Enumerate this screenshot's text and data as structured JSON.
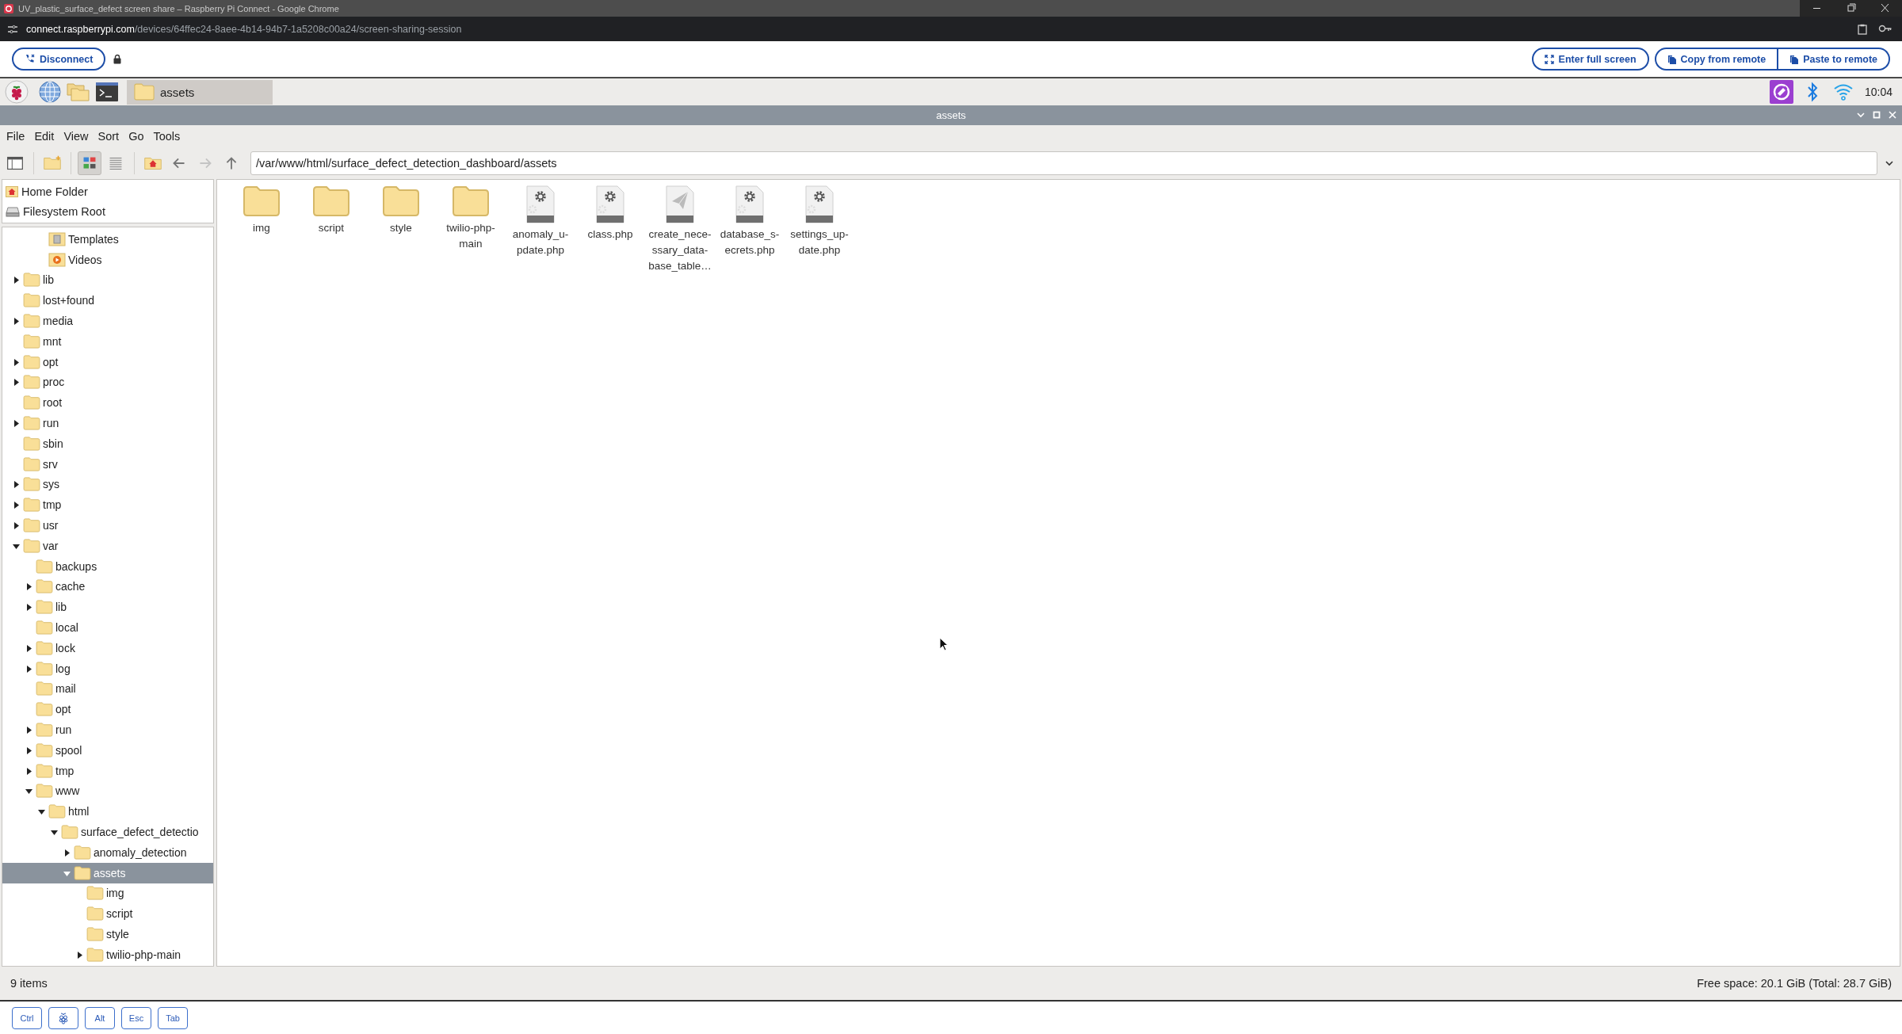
{
  "browser": {
    "title": "UV_plastic_surface_defect screen share – Raspberry Pi Connect - Google Chrome",
    "url_host": "connect.raspberrypi.com",
    "url_path": "/devices/64ffec24-8aee-4b14-94b7-1a5208c00a24/screen-sharing-session"
  },
  "connect_toolbar": {
    "disconnect": "Disconnect",
    "fullscreen": "Enter full screen",
    "copy": "Copy from remote",
    "paste": "Paste to remote"
  },
  "taskbar": {
    "window_button": "assets",
    "clock": "10:04"
  },
  "window": {
    "title": "assets",
    "menu": [
      "File",
      "Edit",
      "View",
      "Sort",
      "Go",
      "Tools"
    ],
    "view_buttons": [
      {
        "kind": "icons",
        "selected": true
      },
      {
        "kind": "list",
        "selected": false
      }
    ],
    "navigation": [
      {
        "kind": "back",
        "disabled": false
      },
      {
        "kind": "forward",
        "disabled": true
      },
      {
        "kind": "up",
        "disabled": false
      }
    ],
    "path": "/var/www/html/surface_defect_detection_dashboard/assets",
    "places": [
      {
        "kind": "home",
        "label": "Home Folder"
      },
      {
        "kind": "drive",
        "label": "Filesystem Root"
      }
    ],
    "tree": {
      "partial_branch": [
        {
          "kind": "templates",
          "label": "Templates"
        },
        {
          "kind": "videos",
          "label": "Videos"
        }
      ],
      "items": [
        {
          "label": "lib",
          "expandable": true,
          "expanded": false,
          "selected": false
        },
        {
          "label": "lost+found",
          "expandable": false,
          "selected": false
        },
        {
          "label": "media",
          "expandable": true,
          "expanded": false,
          "selected": false
        },
        {
          "label": "mnt",
          "expandable": false,
          "selected": false
        },
        {
          "label": "opt",
          "expandable": true,
          "expanded": false,
          "selected": false
        },
        {
          "label": "proc",
          "expandable": true,
          "expanded": false,
          "selected": false
        },
        {
          "label": "root",
          "expandable": false,
          "selected": false
        },
        {
          "label": "run",
          "expandable": true,
          "expanded": false,
          "selected": false
        },
        {
          "label": "sbin",
          "expandable": false,
          "selected": false
        },
        {
          "label": "srv",
          "expandable": false,
          "selected": false
        },
        {
          "label": "sys",
          "expandable": true,
          "expanded": false,
          "selected": false
        },
        {
          "label": "tmp",
          "expandable": true,
          "expanded": false,
          "selected": false
        },
        {
          "label": "usr",
          "expandable": true,
          "expanded": false,
          "selected": false
        },
        {
          "label": "var",
          "expandable": true,
          "expanded": true,
          "selected": false,
          "children": [
            {
              "label": "backups",
              "expandable": false,
              "selected": false
            },
            {
              "label": "cache",
              "expandable": true,
              "expanded": false,
              "selected": false
            },
            {
              "label": "lib",
              "expandable": true,
              "expanded": false,
              "selected": false
            },
            {
              "label": "local",
              "expandable": false,
              "selected": false
            },
            {
              "label": "lock",
              "expandable": true,
              "expanded": false,
              "selected": false
            },
            {
              "label": "log",
              "expandable": true,
              "expanded": false,
              "selected": false
            },
            {
              "label": "mail",
              "expandable": false,
              "selected": false
            },
            {
              "label": "opt",
              "expandable": false,
              "selected": false
            },
            {
              "label": "run",
              "expandable": true,
              "expanded": false,
              "selected": false
            },
            {
              "label": "spool",
              "expandable": true,
              "expanded": false,
              "selected": false
            },
            {
              "label": "tmp",
              "expandable": true,
              "expanded": false,
              "selected": false
            },
            {
              "label": "www",
              "expandable": true,
              "expanded": true,
              "selected": false,
              "children": [
                {
                  "label": "html",
                  "expandable": true,
                  "expanded": true,
                  "selected": false,
                  "children": [
                    {
                      "label": "surface_defect_detectio",
                      "expandable": true,
                      "expanded": true,
                      "selected": false,
                      "children": [
                        {
                          "label": "anomaly_detection",
                          "expandable": true,
                          "expanded": false,
                          "selected": false
                        },
                        {
                          "label": "assets",
                          "expandable": true,
                          "expanded": true,
                          "selected": true,
                          "children": [
                            {
                              "label": "img",
                              "expandable": false,
                              "selected": false
                            },
                            {
                              "label": "script",
                              "expandable": false,
                              "selected": false
                            },
                            {
                              "label": "style",
                              "expandable": false,
                              "selected": false
                            },
                            {
                              "label": "twilio-php-main",
                              "expandable": true,
                              "expanded": false,
                              "selected": false
                            }
                          ]
                        }
                      ]
                    }
                  ]
                }
              ]
            }
          ]
        }
      ]
    },
    "files": [
      {
        "kind": "folder",
        "lines": [
          "img"
        ]
      },
      {
        "kind": "folder",
        "lines": [
          "script"
        ]
      },
      {
        "kind": "folder",
        "lines": [
          "style"
        ]
      },
      {
        "kind": "folder",
        "lines": [
          "twilio-php-",
          "main"
        ]
      },
      {
        "kind": "php",
        "lines": [
          "anomaly_u-",
          "pdate.php"
        ]
      },
      {
        "kind": "php",
        "lines": [
          "class.php"
        ]
      },
      {
        "kind": "send",
        "lines": [
          "create_nece-",
          "ssary_data-",
          "base_table…"
        ]
      },
      {
        "kind": "php",
        "lines": [
          "database_s-",
          "ecrets.php"
        ]
      },
      {
        "kind": "php",
        "lines": [
          "settings_up-",
          "date.php"
        ]
      }
    ],
    "status": {
      "count": "9 items",
      "free_space": "Free space: 20.1 GiB (Total: 28.7 GiB)"
    }
  },
  "keys": [
    {
      "kind": "text",
      "label": "Ctrl"
    },
    {
      "kind": "logo"
    },
    {
      "kind": "text",
      "label": "Alt"
    },
    {
      "kind": "text",
      "label": "Esc"
    },
    {
      "kind": "text",
      "label": "Tab"
    }
  ]
}
